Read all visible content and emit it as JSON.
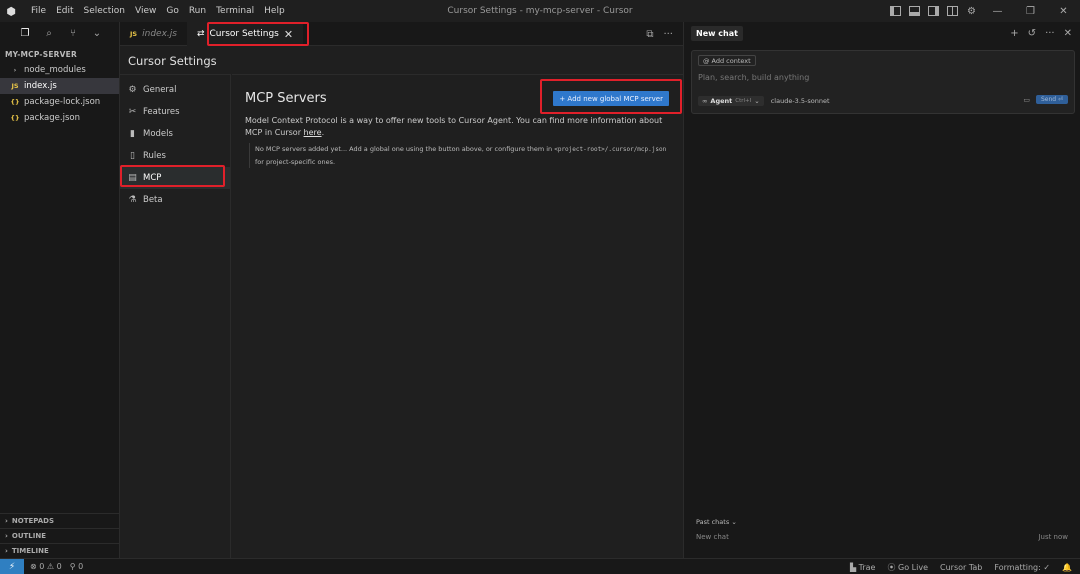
{
  "titlebar": {
    "logo": "⬢",
    "menu": [
      "File",
      "Edit",
      "Selection",
      "View",
      "Go",
      "Run",
      "Terminal",
      "Help"
    ],
    "window_title": "Cursor Settings - my-mcp-server - Cursor",
    "icons": [
      "sidebar-left-icon",
      "panel-bottom-icon",
      "sidebar-right-icon",
      "layout-icon",
      "gear-icon"
    ],
    "minimize": "—",
    "restore": "❐",
    "close": "✕"
  },
  "sidebar": {
    "toolbar_glyphs": {
      "explorer": "❐",
      "search": "⌕",
      "scm": "⑂",
      "more": "⌄"
    },
    "project_title": "MY-MCP-SERVER",
    "items": [
      {
        "label": "node_modules",
        "icon": "›",
        "type": "folder"
      },
      {
        "label": "index.js",
        "icon": "JS",
        "type": "js"
      },
      {
        "label": "package-lock.json",
        "icon": "{}",
        "type": "json"
      },
      {
        "label": "package.json",
        "icon": "{}",
        "type": "json"
      }
    ],
    "bottom_sections": [
      "NOTEPADS",
      "OUTLINE",
      "TIMELINE"
    ],
    "section_chevron": "›"
  },
  "editor": {
    "tabs": [
      {
        "label": "index.js",
        "badge": "JS",
        "active": false
      },
      {
        "label": "Cursor Settings",
        "icon": "⇄",
        "close": "✕",
        "active": true
      }
    ],
    "tab_actions": {
      "split": "⧉",
      "more": "···"
    },
    "settings_title": "Cursor Settings",
    "nav": [
      {
        "label": "General",
        "icon": "⚙"
      },
      {
        "label": "Features",
        "icon": "✂"
      },
      {
        "label": "Models",
        "icon": "▮"
      },
      {
        "label": "Rules",
        "icon": "▯"
      },
      {
        "label": "MCP",
        "icon": "▤"
      },
      {
        "label": "Beta",
        "icon": "⚗"
      }
    ],
    "mcp": {
      "heading": "MCP Servers",
      "add_button": "+ Add new global MCP server",
      "description": "Model Context Protocol is a way to offer new tools to Cursor Agent. You can find more information about MCP in Cursor ",
      "link": "here",
      "period": ".",
      "empty_part1": "No MCP servers added yet... Add a global one using the button above, or configure them in ",
      "empty_code": "<project-root>/.cursor/mcp.json",
      "empty_part2": "for project-specific ones."
    }
  },
  "chat": {
    "title": "New chat",
    "header_glyphs": {
      "add": "+",
      "history": "↺",
      "more": "···",
      "close": "✕"
    },
    "add_context": "Add context",
    "add_context_glyph": "@",
    "placeholder": "Plan, search, build anything",
    "agent_glyph": "∞",
    "agent_label": "Agent",
    "agent_shortcut": "Ctrl+I",
    "dropdown_glyph": "⌄",
    "model": "claude-3.5-sonnet",
    "image_glyph": "▭",
    "send": "Send ⏎",
    "past_chats": "Past chats",
    "past_items": [
      {
        "title": "New chat",
        "time": "Just now"
      }
    ]
  },
  "statusbar": {
    "remote": "⚡",
    "errors": "⊗ 0 ⚠ 0",
    "ports": "⚲ 0",
    "right": [
      "Trae",
      "Go Live",
      "Cursor Tab",
      "Formatting: ✓"
    ],
    "right_glyphs": {
      "trae": "▙",
      "golive": "⦿"
    },
    "bell": "🔔"
  }
}
